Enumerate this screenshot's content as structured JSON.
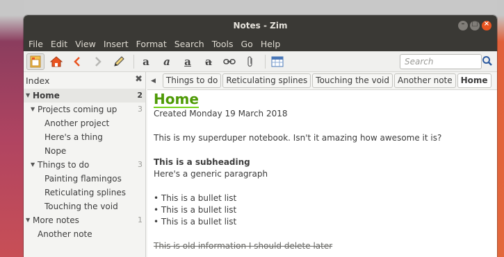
{
  "window": {
    "title": "Notes - Zim"
  },
  "menu": [
    "File",
    "Edit",
    "View",
    "Insert",
    "Format",
    "Search",
    "Tools",
    "Go",
    "Help"
  ],
  "toolbar": {
    "search_placeholder": "Search",
    "icons": [
      "index-pane-icon",
      "home-icon",
      "back-icon",
      "forward-icon",
      "edit-icon",
      "bold-icon",
      "italic-icon",
      "underline-icon",
      "strike-icon",
      "link-icon",
      "attach-icon",
      "calendar-icon",
      "search-icon"
    ]
  },
  "sidebar": {
    "header": "Index",
    "close_glyph": "✖",
    "tree": [
      {
        "label": "Home",
        "level": 0,
        "count": "2",
        "expanded": true,
        "selected": true
      },
      {
        "label": "Projects coming up",
        "level": 1,
        "count": "3",
        "expanded": true
      },
      {
        "label": "Another project",
        "level": 2
      },
      {
        "label": "Here's a thing",
        "level": 2
      },
      {
        "label": "Nope",
        "level": 2
      },
      {
        "label": "Things to do",
        "level": 1,
        "count": "3",
        "expanded": true
      },
      {
        "label": "Painting flamingos",
        "level": 2
      },
      {
        "label": "Reticulating splines",
        "level": 2
      },
      {
        "label": "Touching the void",
        "level": 2
      },
      {
        "label": "More notes",
        "level": 0,
        "count": "1",
        "expanded": true
      },
      {
        "label": "Another note",
        "level": 1
      }
    ]
  },
  "tabs": [
    "Things to do",
    "Reticulating splines",
    "Touching the void",
    "Another note",
    "Home"
  ],
  "page": {
    "heading": "Home",
    "created": "Created Monday 19 March 2018",
    "intro": "This is my superduper notebook. Isn't it amazing how awesome it is?",
    "subheading": "This is a subheading",
    "paragraph": "Here's a generic paragraph",
    "bullets": [
      "• This is a bullet list",
      "• This is a bullet list",
      "• This is a bullet list"
    ],
    "strike": "This is old information I should delete later"
  },
  "colors": {
    "accent": "#e95420",
    "heading": "#4e9a06",
    "titlebar": "#3a3935"
  }
}
